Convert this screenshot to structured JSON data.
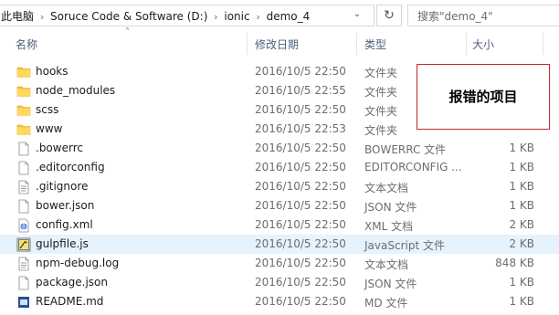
{
  "address_bar": {
    "crumbs": [
      "此电脑",
      "Soruce Code & Software (D:)",
      "ionic",
      "demo_4"
    ]
  },
  "search": {
    "placeholder": "搜索\"demo_4\""
  },
  "columns": {
    "name": "名称",
    "date": "修改日期",
    "type": "类型",
    "size": "大小"
  },
  "files": [
    {
      "name": "hooks",
      "date": "2016/10/5 22:50",
      "type": "文件夹",
      "size": "",
      "icon": "folder-icon"
    },
    {
      "name": "node_modules",
      "date": "2016/10/5 22:55",
      "type": "文件夹",
      "size": "",
      "icon": "folder-icon"
    },
    {
      "name": "scss",
      "date": "2016/10/5 22:50",
      "type": "文件夹",
      "size": "",
      "icon": "folder-icon"
    },
    {
      "name": "www",
      "date": "2016/10/5 22:53",
      "type": "文件夹",
      "size": "",
      "icon": "folder-icon"
    },
    {
      "name": ".bowerrc",
      "date": "2016/10/5 22:50",
      "type": "BOWERRC 文件",
      "size": "1 KB",
      "icon": "file-icon"
    },
    {
      "name": ".editorconfig",
      "date": "2016/10/5 22:50",
      "type": "EDITORCONFIG ...",
      "size": "1 KB",
      "icon": "file-icon"
    },
    {
      "name": ".gitignore",
      "date": "2016/10/5 22:50",
      "type": "文本文档",
      "size": "1 KB",
      "icon": "text-file-icon"
    },
    {
      "name": "bower.json",
      "date": "2016/10/5 22:50",
      "type": "JSON 文件",
      "size": "1 KB",
      "icon": "file-icon"
    },
    {
      "name": "config.xml",
      "date": "2016/10/5 22:50",
      "type": "XML 文档",
      "size": "2 KB",
      "icon": "xml-file-icon"
    },
    {
      "name": "gulpfile.js",
      "date": "2016/10/5 22:50",
      "type": "JavaScript 文件",
      "size": "2 KB",
      "icon": "js-file-icon"
    },
    {
      "name": "npm-debug.log",
      "date": "2016/10/5 22:50",
      "type": "文本文档",
      "size": "848 KB",
      "icon": "text-file-icon"
    },
    {
      "name": "package.json",
      "date": "2016/10/5 22:50",
      "type": "JSON 文件",
      "size": "1 KB",
      "icon": "file-icon"
    },
    {
      "name": "README.md",
      "date": "2016/10/5 22:50",
      "type": "MD 文件",
      "size": "1 KB",
      "icon": "md-file-icon"
    }
  ],
  "annotation": {
    "text": "报错的项目",
    "border_color": "#c0282d"
  },
  "colors": {
    "folder": "#f5c242",
    "header_text": "#4c607a",
    "selected_row": "#e5f3ff"
  }
}
